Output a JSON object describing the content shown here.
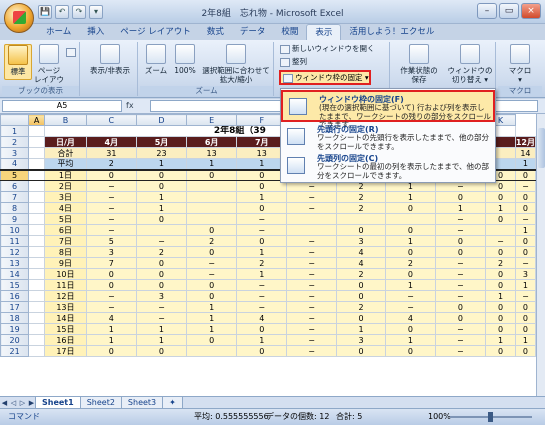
{
  "window": {
    "title": "2年8組　忘れ物 - Microsoft Excel"
  },
  "qat": {
    "save": "💾",
    "undo": "↶",
    "redo": "↷",
    "more": "▾"
  },
  "controls": {
    "min": "–",
    "max": "▭",
    "close": "×"
  },
  "tabs": [
    "ホーム",
    "挿入",
    "ページ レイアウト",
    "数式",
    "データ",
    "校閲",
    "表示",
    "活用しよう！エクセル"
  ],
  "active_tab": "表示",
  "ribbon": {
    "normal": "標準",
    "pagelayout": "ページ\nレイアウト",
    "showhide": "表示/非表示",
    "zoom": "ズーム",
    "zoom100": "100%",
    "zoomsel": "選択範囲に合わせて\n拡大/縮小",
    "newwin": "新しいウィンドウを開く",
    "arrange": "整列",
    "freeze": "ウィンドウ枠の固定 ▾",
    "save_ws": "作業状態の\n保存",
    "switch": "ウィンドウの\n切り替え ▾",
    "macro": "マクロ\n▾",
    "group_book": "ブックの表示",
    "group_zoom": "ズーム",
    "group_macro": "マクロ"
  },
  "formula": {
    "namebox": "A5",
    "fx": "fx",
    "value": ""
  },
  "dropdown": {
    "items": [
      {
        "title": "ウィンドウ枠の固定(F)",
        "desc": "(現在の選択範囲に基づいて) 行および列を表示したままで、ワークシートの残りの部分をスクロールできます。"
      },
      {
        "title": "先頭行の固定(R)",
        "desc": "ワークシートの先頭行を表示したままで、他の部分をスクロールできます。"
      },
      {
        "title": "先頭列の固定(C)",
        "desc": "ワークシートの最初の列を表示したままで、他の部分をスクロールできます。"
      }
    ]
  },
  "sheet": {
    "columns": [
      "A",
      "B",
      "C",
      "D",
      "E",
      "F",
      "G",
      "H",
      "I",
      "J",
      "K"
    ],
    "title": "2年8組（39",
    "title_tail": "^）",
    "months": [
      "日/月",
      "4月",
      "5月",
      "6月",
      "7月",
      "",
      "",
      "",
      "",
      "",
      "12月"
    ],
    "total": [
      "合計",
      "31",
      "23",
      "13",
      "13",
      "",
      "",
      "",
      "",
      "",
      "14"
    ],
    "avg": [
      "平均",
      "2",
      "1",
      "1",
      "1",
      "",
      "",
      "",
      "",
      "",
      "1"
    ],
    "days": [
      [
        "1日",
        "0",
        "0",
        "0",
        "0",
        "−",
        "4",
        "0",
        "0",
        "0",
        "0"
      ],
      [
        "2日",
        "−",
        "0",
        "",
        "0",
        "−",
        "2",
        "1",
        "−",
        "0",
        "−"
      ],
      [
        "3日",
        "−",
        "1",
        "",
        "1",
        "−",
        "2",
        "1",
        "0",
        "0",
        "0"
      ],
      [
        "4日",
        "−",
        "1",
        "",
        "0",
        "−",
        "2",
        "0",
        "1",
        "1",
        "0"
      ],
      [
        "5日",
        "−",
        "0",
        "",
        "−",
        "",
        "",
        "",
        "−",
        "0",
        "−"
      ],
      [
        "6日",
        "−",
        "",
        "0",
        "−",
        "",
        "0",
        "0",
        "−",
        "",
        "1"
      ],
      [
        "7日",
        "5",
        "−",
        "2",
        "0",
        "−",
        "3",
        "1",
        "0",
        "−",
        "0"
      ],
      [
        "8日",
        "3",
        "2",
        "0",
        "1",
        "−",
        "4",
        "0",
        "0",
        "0",
        "0"
      ],
      [
        "9日",
        "7",
        "0",
        "−",
        "2",
        "−",
        "4",
        "2",
        "−",
        "2",
        "−"
      ],
      [
        "10日",
        "0",
        "0",
        "−",
        "1",
        "−",
        "2",
        "0",
        "−",
        "0",
        "3"
      ],
      [
        "11日",
        "0",
        "0",
        "0",
        "−",
        "−",
        "0",
        "1",
        "−",
        "0",
        "1"
      ],
      [
        "12日",
        "−",
        "3",
        "0",
        "−",
        "−",
        "0",
        "−",
        "−",
        "1",
        "−"
      ],
      [
        "13日",
        "−",
        "−",
        "1",
        "−",
        "−",
        "2",
        "−",
        "0",
        "0",
        "0"
      ],
      [
        "14日",
        "4",
        "−",
        "1",
        "4",
        "−",
        "0",
        "4",
        "0",
        "0",
        "0"
      ],
      [
        "15日",
        "1",
        "1",
        "1",
        "0",
        "−",
        "1",
        "0",
        "−",
        "0",
        "0"
      ],
      [
        "16日",
        "1",
        "1",
        "0",
        "1",
        "−",
        "3",
        "1",
        "−",
        "1",
        "1"
      ],
      [
        "17日",
        "0",
        "0",
        "",
        "0",
        "−",
        "0",
        "0",
        "−",
        "0",
        "0"
      ]
    ]
  },
  "sheets": [
    "Sheet1",
    "Sheet2",
    "Sheet3"
  ],
  "status": {
    "mode": "コマンド",
    "avg": "平均: 0.555555556",
    "count": "データの個数: 12",
    "sum": "合計: 5",
    "zoom": "100%"
  }
}
